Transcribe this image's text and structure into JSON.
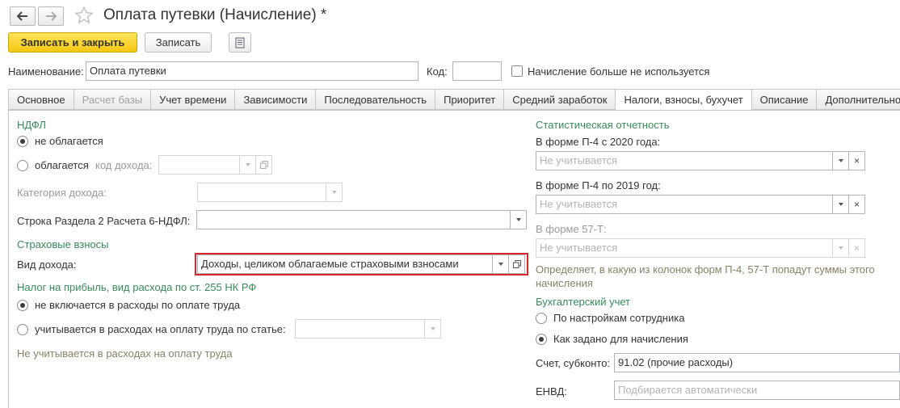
{
  "window": {
    "title": "Оплата путевки (Начисление) *"
  },
  "toolbar": {
    "save_close_label": "Записать и закрыть",
    "save_label": "Записать"
  },
  "header": {
    "name_label": "Наименование:",
    "name_value": "Оплата путевки",
    "code_label": "Код:",
    "code_value": "",
    "unused_label": "Начисление больше не используется"
  },
  "tabs": [
    {
      "label": "Основное"
    },
    {
      "label": "Расчет базы"
    },
    {
      "label": "Учет времени"
    },
    {
      "label": "Зависимости"
    },
    {
      "label": "Последовательность"
    },
    {
      "label": "Приоритет"
    },
    {
      "label": "Средний заработок"
    },
    {
      "label": "Налоги, взносы, бухучет"
    },
    {
      "label": "Описание"
    },
    {
      "label": "Дополнительно"
    }
  ],
  "left": {
    "ndfl_title": "НДФЛ",
    "not_taxed": "не облагается",
    "taxed": "облагается",
    "income_code_label": "код дохода:",
    "income_category_label": "Категория дохода:",
    "section2_label": "Строка Раздела 2 Расчета 6-НДФЛ:",
    "insurance_title": "Страховые взносы",
    "income_type_label": "Вид дохода:",
    "income_type_value": "Доходы, целиком облагаемые страховыми взносами",
    "profit_tax_title": "Налог на прибыль, вид расхода по ст. 255 НК РФ",
    "not_included": "не включается в расходы по оплате труда",
    "included_by_article": "учитывается в расходах на оплату труда по статье:",
    "not_accounted_hint": "Не учитывается в расходах на оплату труда"
  },
  "right": {
    "stat_title": "Статистическая отчетность",
    "p4_2020_label": "В форме П-4 с 2020 года:",
    "p4_2020_value": "Не учитывается",
    "p4_2019_label": "В форме П-4 по 2019 год:",
    "p4_2019_value": "Не учитывается",
    "f57t_label": "В форме 57-Т:",
    "f57t_value": "Не учитывается",
    "stat_hint": "Определяет, в какую из колонок форм П-4, 57-Т попадут суммы этого начисления",
    "accounting_title": "Бухгалтерский учет",
    "by_employee": "По настройкам сотрудника",
    "as_accrual": "Как задано для начисления",
    "account_label": "Счет, субконто:",
    "account_value": "91.02 (прочие расходы)",
    "envd_label": "ЕНВД:",
    "envd_placeholder": "Подбирается автоматически"
  },
  "colors": {
    "section": "#3a8a5a",
    "highlight": "#d9262c",
    "primary": "#f5c711"
  }
}
